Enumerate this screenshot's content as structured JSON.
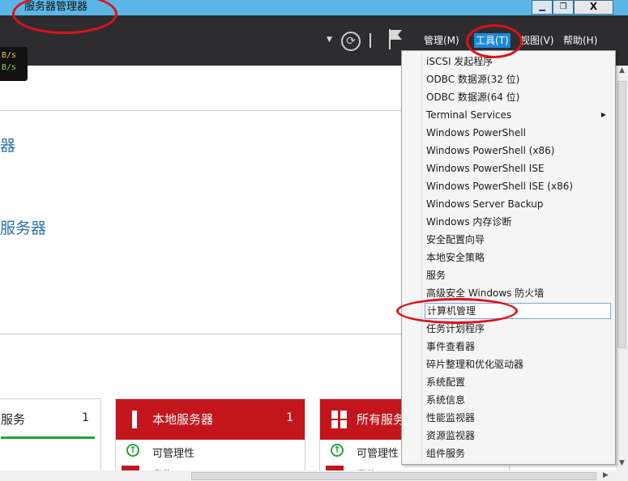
{
  "window": {
    "title": "服务器管理器",
    "minimize": "▁",
    "restore": "❐",
    "close": "X"
  },
  "header": {
    "menu": {
      "manage": "管理(M)",
      "tools": "工具(T)",
      "view": "视图(V)",
      "help": "帮助(H)"
    },
    "net_up": "B/s",
    "net_down": "B/s"
  },
  "main": {
    "heading_fragment_1": "器",
    "heading_fragment_2": "服务器"
  },
  "tiles": [
    {
      "title": "服务",
      "count": "1"
    },
    {
      "title": "本地服务器",
      "count": "1",
      "row1": "可管理性",
      "row2": "事件"
    },
    {
      "title": "所有服务",
      "row1": "可管理性",
      "row2": "事件"
    }
  ],
  "tools_menu": {
    "items": [
      "iSCSI 发起程序",
      "ODBC 数据源(32 位)",
      "ODBC 数据源(64 位)",
      "Terminal Services",
      "Windows PowerShell",
      "Windows PowerShell (x86)",
      "Windows PowerShell ISE",
      "Windows PowerShell ISE (x86)",
      "Windows Server Backup",
      "Windows 内存诊断",
      "安全配置向导",
      "本地安全策略",
      "服务",
      "高级安全 Windows 防火墙",
      "计算机管理",
      "任务计划程序",
      "事件查看器",
      "碎片整理和优化驱动器",
      "系统配置",
      "系统信息",
      "性能监视器",
      "资源监视器",
      "组件服务"
    ],
    "highlighted_index": 14,
    "submenu_index": 3
  },
  "colors": {
    "title_bar": "#5ab6e6",
    "header": "#2d2d30",
    "menu_active": "#1c8ad9",
    "tile_red": "#c3161c",
    "status_ok": "#22a33a",
    "annotation": "#e0101a"
  },
  "icons": {
    "refresh": "refresh-icon",
    "flag": "notification-flag-icon",
    "status_ok": "up-arrow-circle-icon",
    "submenu": "chevron-right-icon"
  }
}
